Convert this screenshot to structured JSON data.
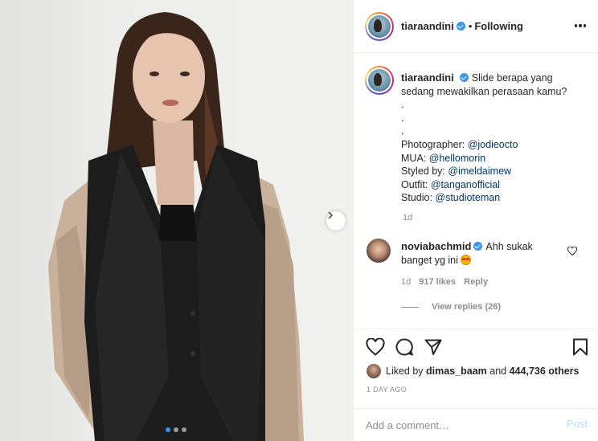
{
  "post": {
    "username": "tiaraandini",
    "following_label": "Following",
    "separator": "•"
  },
  "caption": {
    "username": "tiaraandini",
    "text": "Slide berapa yang sedang mewakilkan perasaan kamu?",
    "dots": [
      ".",
      ".",
      "."
    ],
    "credits": [
      {
        "label": "Photographer: ",
        "handle": "@jodieocto"
      },
      {
        "label": "MUA: ",
        "handle": "@hellomorin"
      },
      {
        "label": "Styled by: ",
        "handle": "@imeldaimew"
      },
      {
        "label": "Outfit: ",
        "handle": "@tanganofficial"
      },
      {
        "label": "Studio: ",
        "handle": "@studioteman"
      }
    ],
    "time": "1d"
  },
  "comment": {
    "username": "noviabachmid",
    "text": "Ahh sukak banget yg ini",
    "emoji": "star-struck-emoji",
    "time": "1d",
    "likes": "917 likes",
    "reply_label": "Reply",
    "view_replies": "View replies (26)"
  },
  "likes": {
    "prefix": "Liked by",
    "user": "dimas_baam",
    "middle": "and",
    "count": "444,736 others"
  },
  "date": "1 DAY AGO",
  "add_comment": {
    "placeholder": "Add a comment…",
    "post_label": "Post"
  },
  "carousel": {
    "slide_count": 3,
    "active_index": 0
  },
  "icons": [
    "verified-badge-icon",
    "more-options-icon",
    "heart-icon",
    "comment-icon",
    "share-icon",
    "bookmark-icon",
    "chevron-right-icon"
  ],
  "colors": {
    "accent": "#3897f0",
    "link": "#00376b",
    "muted": "#8e8e8e",
    "post_disabled": "#b2dffc"
  }
}
